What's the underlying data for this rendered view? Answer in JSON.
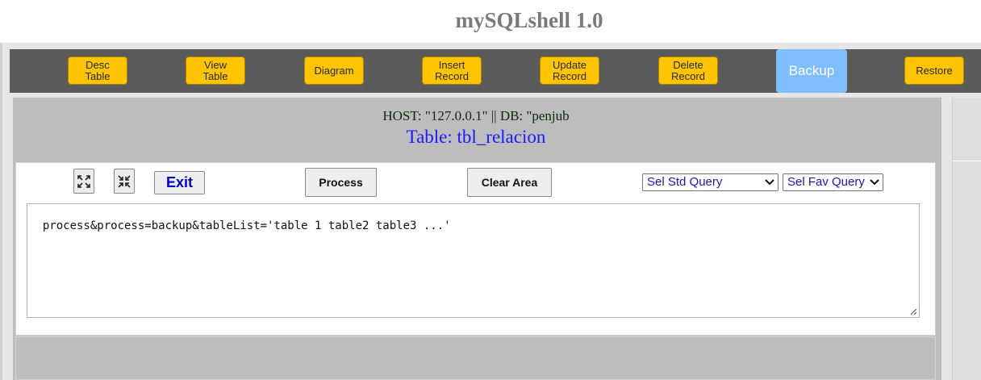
{
  "app": {
    "title": "mySQLshell 1.0"
  },
  "toolbar": {
    "buttons": [
      {
        "label": "Desc\nTable"
      },
      {
        "label": "View\nTable"
      },
      {
        "label": "Diagram"
      },
      {
        "label": "Insert\nRecord"
      },
      {
        "label": "Update\nRecord"
      },
      {
        "label": "Delete\nRecord"
      },
      {
        "label": "Backup",
        "active": true
      },
      {
        "label": "Restore"
      }
    ],
    "accent_color": "#ffc400",
    "active_color": "#80bfff"
  },
  "header": {
    "host_line": "HOST: \"127.0.0.1\" || DB: \"penjub",
    "table_line": "Table: tbl_relacion"
  },
  "query_panel": {
    "expand_icon": "expand-icon",
    "collapse_icon": "collapse-icon",
    "exit_label": "Exit",
    "process_label": "Process",
    "clear_label": "Clear Area",
    "std_query_select": "Sel Std Query",
    "fav_query_select": "Sel Fav Query",
    "query_text": "process&process=backup&tableList='table 1 table2 table3 ...'"
  }
}
